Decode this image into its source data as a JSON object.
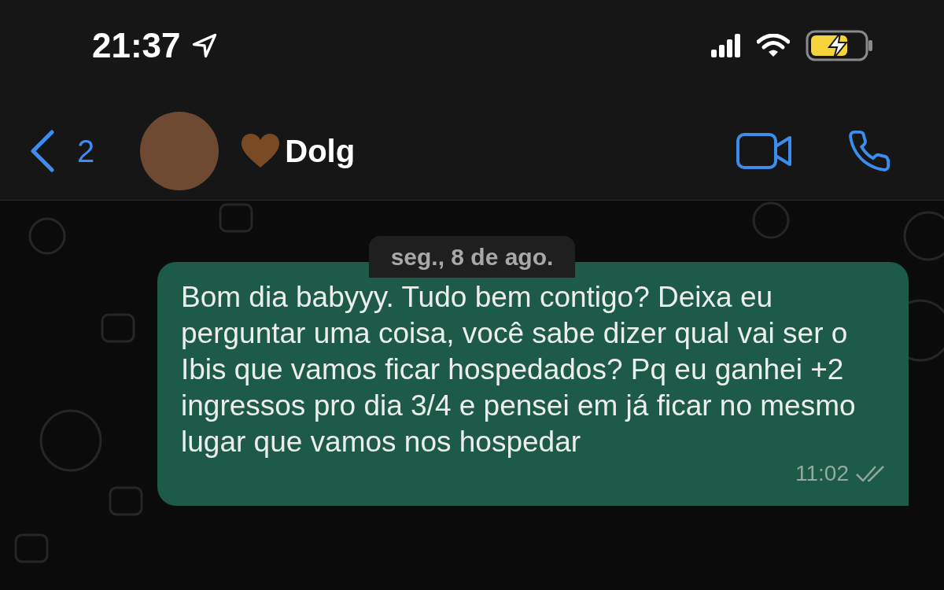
{
  "status_bar": {
    "time": "21:37",
    "location_on": true,
    "charging": true
  },
  "header": {
    "back_count": "2",
    "contact_name": "Dolg"
  },
  "date_label": "seg., 8 de ago.",
  "messages": [
    {
      "text": "Bom dia babyyy. Tudo bem contigo? Deixa eu perguntar uma coisa, você sabe dizer qual vai ser o Ibis que vamos ficar hospedados? Pq eu ganhei +2 ingressos pro dia 3/4 e pensei em já ficar no mesmo lugar que vamos nos hospedar",
      "time": "11:02",
      "outgoing": true,
      "read": false
    }
  ]
}
